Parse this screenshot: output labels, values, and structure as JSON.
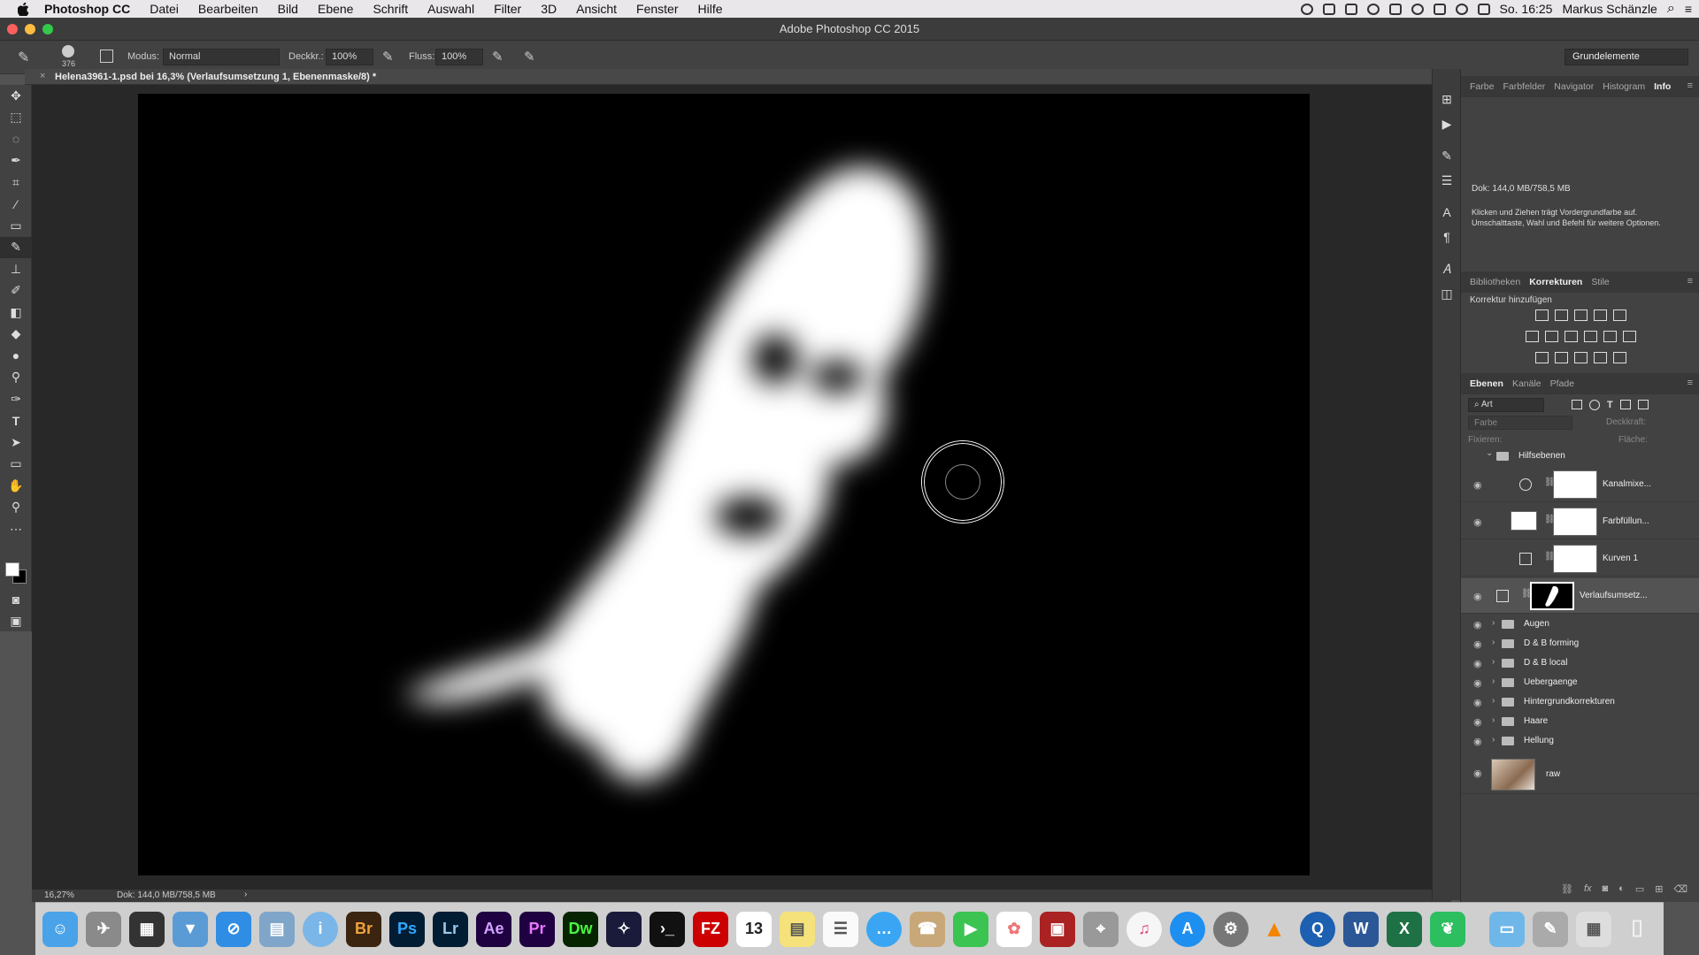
{
  "menubar": {
    "app": "Photoshop CC",
    "items": [
      "Datei",
      "Bearbeiten",
      "Bild",
      "Ebene",
      "Schrift",
      "Auswahl",
      "Filter",
      "3D",
      "Ansicht",
      "Fenster",
      "Hilfe"
    ],
    "clock": "So. 16:25",
    "user": "Markus Schänzle"
  },
  "window": {
    "title": "Adobe Photoshop CC 2015"
  },
  "options": {
    "brush_size": "376",
    "modus_label": "Modus:",
    "modus_value": "Normal",
    "deckkraft_label": "Deckkr.:",
    "deckkraft_value": "100%",
    "fluss_label": "Fluss:",
    "fluss_value": "100%",
    "workspace": "Grundelemente"
  },
  "document": {
    "tab_title": "Helena3961-1.psd bei 16,3% (Verlaufsumsetzung 1, Ebenenmaske/8) *",
    "close_glyph": "×"
  },
  "status": {
    "zoom": "16,27%",
    "doc": "Dok: 144,0 MB/758,5 MB",
    "arrow": "›"
  },
  "info_panel": {
    "tabs": [
      "Farbe",
      "Farbfelder",
      "Navigator",
      "Histogram",
      "Info"
    ],
    "active_tab": "Info",
    "doc_size": "Dok: 144,0 MB/758,5 MB",
    "hint_line1": "Klicken und Ziehen trägt Vordergrundfarbe auf.",
    "hint_line2": "Umschalttaste, Wahl und Befehl für weitere Optionen."
  },
  "adjust_panel": {
    "tabs": [
      "Bibliotheken",
      "Korrekturen",
      "Stile"
    ],
    "active_tab": "Korrekturen",
    "subtitle": "Korrektur hinzufügen"
  },
  "layers_panel": {
    "tabs": [
      "Ebenen",
      "Kanäle",
      "Pfade"
    ],
    "active_tab": "Ebenen",
    "filter_kind": "Art",
    "blend_mode": "Farbe",
    "opacity_label": "Deckkraft:",
    "lock_label": "Fixieren:",
    "fill_label": "Fläche:",
    "group_open": "Hilfsebenen",
    "adjust_layers": [
      "Kanalmixe...",
      "Farbfüllun...",
      "Kurven 1",
      "Verlaufsumsetz..."
    ],
    "groups": [
      "Augen",
      "D & B forming",
      "D & B local",
      "Uebergaenge",
      "Hintergrundkorrekturen",
      "Haare",
      "Hellung"
    ],
    "base_layer": "raw"
  },
  "icons": {
    "eye": "◉",
    "chevron_right": "›",
    "chevron_down": "⌄",
    "search": "⌕"
  },
  "dock": {
    "labels": [
      "Br",
      "Ps",
      "Lr",
      "Ae",
      "Pr",
      "Dw",
      "FZ",
      "13",
      "W",
      "X"
    ]
  },
  "colors": {
    "ps_blue": "#31a8ff",
    "traffic_red": "#fc605c",
    "traffic_yellow": "#fdbc40",
    "traffic_green": "#34c84a"
  }
}
